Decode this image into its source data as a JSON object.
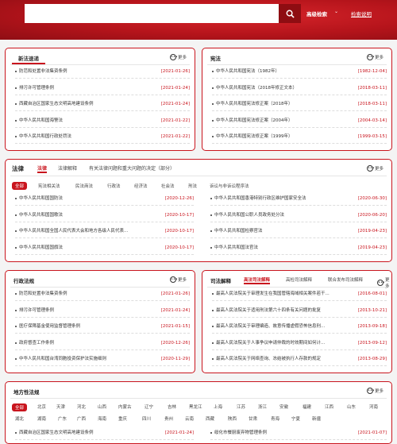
{
  "header": {
    "search_placeholder": "",
    "advanced_search": "高级检索",
    "search_help": "检索说明"
  },
  "new_laws": {
    "title": "新法速递",
    "more": "更多",
    "items": [
      {
        "title": "防范和处置非法集资条例",
        "date": "[2021-01-26]"
      },
      {
        "title": "排污许可管理条例",
        "date": "[2021-01-24]"
      },
      {
        "title": "西藏自治区国家生态文明高地建设条例",
        "date": "[2021-01-24]"
      },
      {
        "title": "中华人民共和国海警法",
        "date": "[2021-01-22]"
      },
      {
        "title": "中华人民共和国行政处罚法",
        "date": "[2021-01-22]"
      }
    ]
  },
  "constitution": {
    "title": "宪法",
    "more": "更多",
    "items": [
      {
        "title": "中华人民共和国宪法（1982年）",
        "date": "[1982-12-04]"
      },
      {
        "title": "中华人民共和国宪法（2018年修正文本）",
        "date": "[2018-03-11]"
      },
      {
        "title": "中华人民共和国宪法修正案（2018年）",
        "date": "[2018-03-11]"
      },
      {
        "title": "中华人民共和国宪法修正案（2004年）",
        "date": "[2004-03-14]"
      },
      {
        "title": "中华人民共和国宪法修正案（1999年）",
        "date": "[1999-03-15]"
      }
    ]
  },
  "laws": {
    "title": "法律",
    "more": "更多",
    "tabs": [
      "法律",
      "法律解释",
      "有关法律问题和重大问题的决定（部分）"
    ],
    "categories": [
      "全部",
      "宪法相关法",
      "民法商法",
      "行政法",
      "经济法",
      "社会法",
      "刑法",
      "诉讼与非诉讼程序法"
    ],
    "left_items": [
      {
        "title": "中华人民共和国国防法",
        "date": "[2020-12-26]"
      },
      {
        "title": "中华人民共和国国歌法",
        "date": "[2020-10-17]"
      },
      {
        "title": "中华人民共和国全国人民代表大会和地方各级人民代表...",
        "date": "[2020-10-17]"
      },
      {
        "title": "中华人民共和国国旗法",
        "date": "[2020-10-17]"
      }
    ],
    "right_items": [
      {
        "title": "中华人民共和国香港特别行政区维护国家安全法",
        "date": "[2020-06-30]"
      },
      {
        "title": "中华人民共和国公职人员政务处分法",
        "date": "[2020-06-20]"
      },
      {
        "title": "中华人民共和国检察官法",
        "date": "[2019-04-23]"
      },
      {
        "title": "中华人民共和国法官法",
        "date": "[2019-04-23]"
      }
    ]
  },
  "admin_regs": {
    "title": "行政法规",
    "more": "更多",
    "items": [
      {
        "title": "防范和处置非法集资条例",
        "date": "[2021-01-26]"
      },
      {
        "title": "排污许可管理条例",
        "date": "[2021-01-24]"
      },
      {
        "title": "医疗保障基金使用监督管理条例",
        "date": "[2021-01-15]"
      },
      {
        "title": "政府督查工作条例",
        "date": "[2020-12-26]"
      },
      {
        "title": "中华人民共和国台湾同胞投资保护法实施细则",
        "date": "[2020-11-29]"
      }
    ]
  },
  "judicial": {
    "title": "司法解释",
    "more": "更多",
    "tabs": [
      "高法司法解释",
      "高检司法解释",
      "联合发布司法解释"
    ],
    "items": [
      {
        "title": "最高人民法院关于审理发生在我国管辖海域相关案件若干...",
        "date": "[2016-08-01]"
      },
      {
        "title": "最高人民法院关于适用刑法第六十四条有关问题的批复",
        "date": "[2013-10-21]"
      },
      {
        "title": "最高人民法院关于审理编造、故意传播虚假恐怖信息刑...",
        "date": "[2013-09-18]"
      },
      {
        "title": "最高人民法院关于人事争议申请仲裁的时效期间如何计...",
        "date": "[2013-09-12]"
      },
      {
        "title": "最高人民法院关于网络查询、冻结被执行人存款的规定",
        "date": "[2013-08-29]"
      }
    ]
  },
  "local_regs": {
    "title": "地方性法规",
    "more": "更多",
    "regions_row1": [
      "全部",
      "北京",
      "天津",
      "河北",
      "山西",
      "内蒙古",
      "辽宁",
      "吉林",
      "黑龙江",
      "上海",
      "江苏",
      "浙江",
      "安徽",
      "福建",
      "江西",
      "山东",
      "河南"
    ],
    "regions_row2": [
      "湖北",
      "湖南",
      "广东",
      "广西",
      "海南",
      "重庆",
      "四川",
      "贵州",
      "云南",
      "西藏",
      "陕西",
      "甘肃",
      "青海",
      "宁夏",
      "新疆"
    ],
    "left_items": [
      {
        "title": "西藏自治区国家生态文明高地建设条例",
        "date": "[2021-01-24]"
      }
    ],
    "right_items": [
      {
        "title": "绥化市餐厨废弃物管理条例",
        "date": "[2021-01-07]"
      }
    ]
  },
  "colors": {
    "brand": "#c9151e",
    "header_dark": "#8e0d12"
  }
}
